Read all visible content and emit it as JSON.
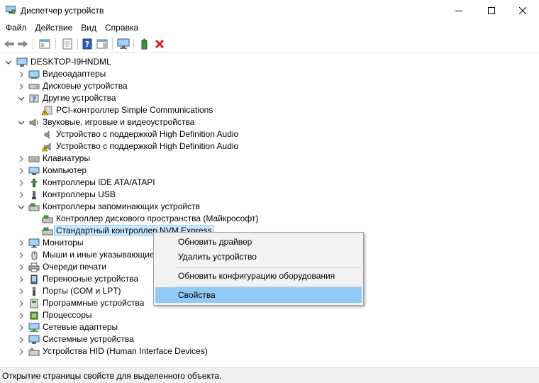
{
  "window": {
    "title": "Диспетчер устройств"
  },
  "menu": [
    "Файл",
    "Действие",
    "Вид",
    "Справка"
  ],
  "toolbar": {
    "buttons": [
      "back-icon",
      "forward-icon",
      "show-hide-tree-icon",
      "properties-icon",
      "help-icon",
      "action-pane-icon",
      "monitor-icon",
      "update-driver-icon",
      "uninstall-icon"
    ]
  },
  "tree": {
    "root": "DESKTOP-I9HNDML",
    "items": [
      {
        "label": "Видеоадаптеры",
        "level": 1,
        "expanded": false,
        "icon": "display-adapter-icon"
      },
      {
        "label": "Дисковые устройства",
        "level": 1,
        "expanded": false,
        "icon": "disk-drive-icon"
      },
      {
        "label": "Другие устройства",
        "level": 1,
        "expanded": true,
        "icon": "other-devices-icon"
      },
      {
        "label": "PCI-контроллер Simple Communications",
        "level": 2,
        "icon": "warning-device-icon"
      },
      {
        "label": "Звуковые, игровые и видеоустройства",
        "level": 1,
        "expanded": true,
        "icon": "speaker-icon"
      },
      {
        "label": "Устройство с поддержкой High Definition Audio",
        "level": 2,
        "icon": "audio-device-icon"
      },
      {
        "label": "Устройство с поддержкой High Definition Audio",
        "level": 2,
        "icon": "audio-warning-icon"
      },
      {
        "label": "Клавиатуры",
        "level": 1,
        "expanded": false,
        "icon": "keyboard-icon"
      },
      {
        "label": "Компьютер",
        "level": 1,
        "expanded": false,
        "icon": "computer-icon"
      },
      {
        "label": "Контроллеры IDE ATA/ATAPI",
        "level": 1,
        "expanded": false,
        "icon": "ide-controller-icon"
      },
      {
        "label": "Контроллеры USB",
        "level": 1,
        "expanded": false,
        "icon": "usb-icon"
      },
      {
        "label": "Контроллеры запоминающих устройств",
        "level": 1,
        "expanded": true,
        "icon": "storage-controller-icon"
      },
      {
        "label": "Контроллер дискового пространства (Майкрософт)",
        "level": 2,
        "icon": "storage-controller-icon"
      },
      {
        "label": "Стандартный контроллер NVM Express",
        "level": 2,
        "icon": "storage-controller-icon",
        "selected": true
      },
      {
        "label": "Мониторы",
        "level": 1,
        "expanded": false,
        "icon": "monitor-icon"
      },
      {
        "label": "Мыши и иные указывающие у",
        "level": 1,
        "expanded": false,
        "icon": "mouse-icon"
      },
      {
        "label": "Очереди печати",
        "level": 1,
        "expanded": false,
        "icon": "printer-icon"
      },
      {
        "label": "Переносные устройства",
        "level": 1,
        "expanded": false,
        "icon": "portable-device-icon"
      },
      {
        "label": "Порты (COM и LPT)",
        "level": 1,
        "expanded": false,
        "icon": "port-icon"
      },
      {
        "label": "Программные устройства",
        "level": 1,
        "expanded": false,
        "icon": "software-device-icon"
      },
      {
        "label": "Процессоры",
        "level": 1,
        "expanded": false,
        "icon": "processor-icon"
      },
      {
        "label": "Сетевые адаптеры",
        "level": 1,
        "expanded": false,
        "icon": "network-adapter-icon"
      },
      {
        "label": "Системные устройства",
        "level": 1,
        "expanded": false,
        "icon": "system-device-icon"
      },
      {
        "label": "Устройства HID (Human Interface Devices)",
        "level": 1,
        "expanded": false,
        "icon": "hid-icon"
      }
    ]
  },
  "context_menu": {
    "items": [
      {
        "label": "Обновить драйвер"
      },
      {
        "label": "Удалить устройство"
      },
      {
        "label": "Обновить конфигурацию оборудования"
      },
      {
        "label": "Свойства",
        "hover": true
      }
    ]
  },
  "status": {
    "text": "Открытие страницы свойств для выделенного объекта."
  },
  "colors": {
    "selection": "#cce8ff",
    "menu_hover": "#91c9f7",
    "uninstall": "#e0201a"
  }
}
